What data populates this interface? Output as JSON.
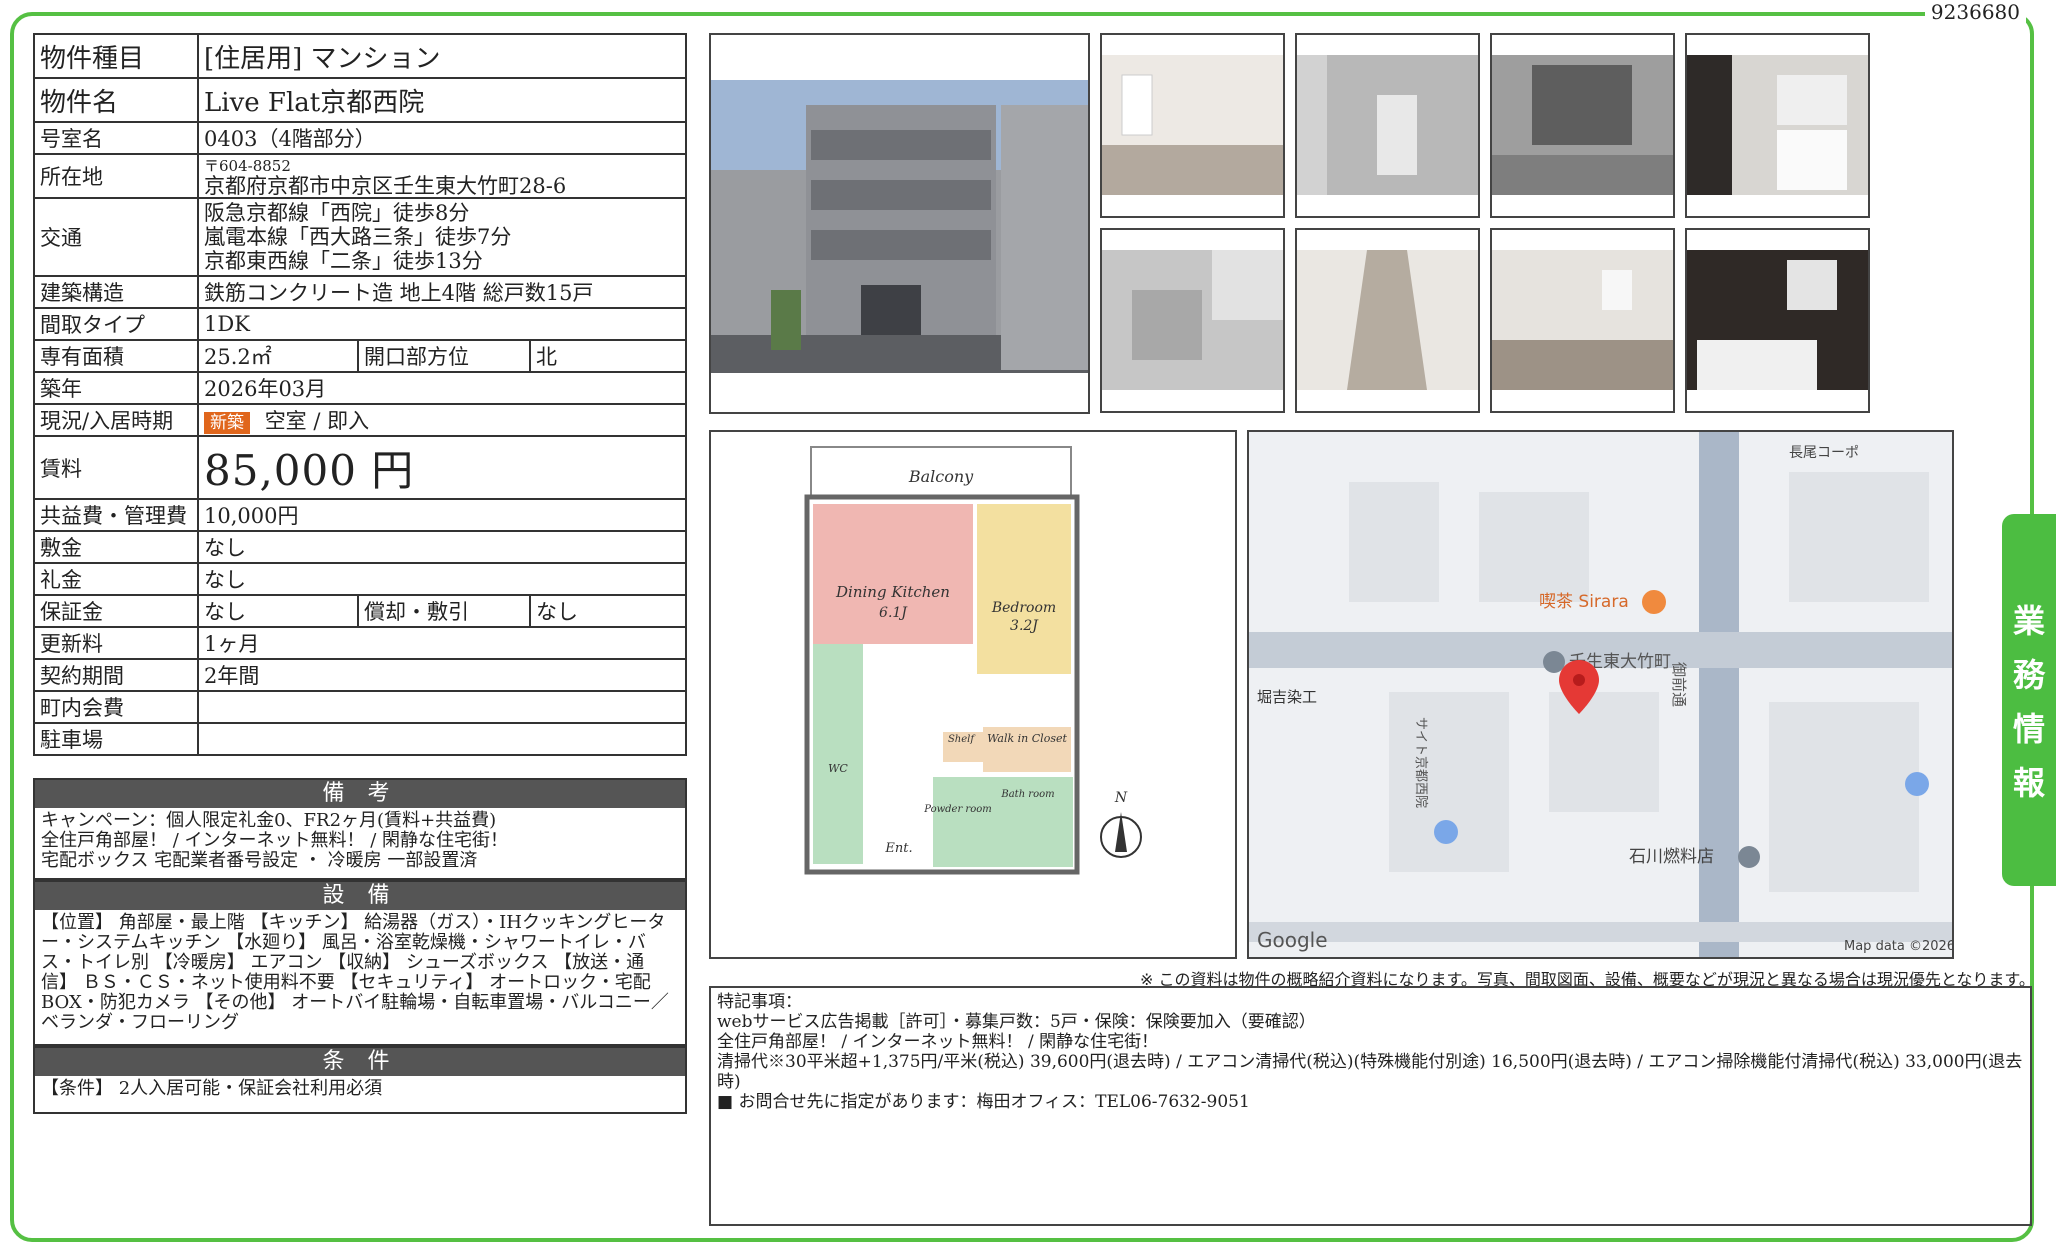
{
  "doc_id": "9236680",
  "side_tab": [
    "業",
    "務",
    "情",
    "報"
  ],
  "property": {
    "type_label": "物件種目",
    "type_value": "[住居用] マンション",
    "name_label": "物件名",
    "name_value": "Live Flat京都西院",
    "room_label": "号室名",
    "room_value": "0403（4階部分）",
    "address_label": "所在地",
    "zip": "〒604-8852",
    "address": "京都府京都市中京区壬生東大竹町28-6",
    "access_label": "交通",
    "access": [
      "阪急京都線「西院」徒歩8分",
      "嵐電本線「西大路三条」徒歩7分",
      "京都東西線「二条」徒歩13分"
    ],
    "structure_label": "建築構造",
    "structure_value": "鉄筋コンクリート造 地上4階 総戸数15戸",
    "layout_label": "間取タイプ",
    "layout_value": "1DK",
    "area_label": "専有面積",
    "area_value": "25.2㎡",
    "facing_label": "開口部方位",
    "facing_value": "北",
    "built_label": "築年",
    "built_value": "2026年03月",
    "status_label": "現況/入居時期",
    "status_badge": "新築",
    "status_value": "空室 / 即入",
    "rent_label": "賃料",
    "rent_value": "85,000 円",
    "fee_label": "共益費・管理費",
    "fee_value": "10,000円",
    "deposit_label": "敷金",
    "deposit_value": "なし",
    "key_money_label": "礼金",
    "key_money_value": "なし",
    "guarantee_label": "保証金",
    "guarantee_value": "なし",
    "amort_label": "償却・敷引",
    "amort_value": "なし",
    "renewal_label": "更新料",
    "renewal_value": "1ヶ月",
    "contract_label": "契約期間",
    "contract_value": "2年間",
    "assoc_label": "町内会費",
    "assoc_value": "",
    "parking_label": "駐車場",
    "parking_value": ""
  },
  "remarks": {
    "title": "備 考",
    "lines": [
      "キャンペーン：個人限定礼金0、FR2ヶ月(賃料+共益費)",
      "全住戸角部屋！ / インターネット無料！ / 閑静な住宅街！",
      "宅配ボックス 宅配業者番号設定 ・ 冷暖房 一部設置済"
    ]
  },
  "equipment": {
    "title": "設 備",
    "text": "【位置】 角部屋・最上階 【キッチン】 給湯器（ガス）・IHクッキングヒーター・システムキッチン 【水廻り】 風呂・浴室乾燥機・シャワートイレ・バス・トイレ別 【冷暖房】 エアコン 【収納】 シューズボックス 【放送・通信】 ＢＳ・ＣＳ・ネット使用料不要 【セキュリティ】 オートロック・宅配BOX・防犯カメラ 【その他】 オートバイ駐輪場・自転車置場・バルコニー／ベランダ・フローリング"
  },
  "conditions": {
    "title": "条 件",
    "text": "【条件】 2人入居可能・保証会社利用必須"
  },
  "floorplan": {
    "balcony": "Balcony",
    "dining": "Dining Kitchen",
    "dining_size": "6.1J",
    "bedroom": "Bedroom",
    "bedroom_size": "3.2J",
    "closet": "Walk in Closet",
    "shelf": "Shelf",
    "powder": "Powder room",
    "bath": "Bath room",
    "wc": "WC",
    "ent": "Ent.",
    "north": "N"
  },
  "map": {
    "labels": [
      "長尾コーポ",
      "喫茶 Sirara",
      "壬生東大竹町",
      "堀吉染工",
      "御前通",
      "サイト京都西院",
      "石川燃料店"
    ],
    "logo": "Google",
    "credit": "Map data ©2026"
  },
  "notice": "※ この資料は物件の概略紹介資料になります。写真、間取図面、設備、概要などが現況と異なる場合は現況優先となります。",
  "notes": {
    "heading": "特記事項：",
    "lines": [
      "webサービス広告掲載［許可］・募集戸数：5戸・保険：保険要加入（要確認）",
      "全住戸角部屋！ / インターネット無料！ / 閑静な住宅街！",
      "清掃代※30平米超+1,375円/平米(税込) 39,600円(退去時) / エアコン清掃代(税込)(特殊機能付別途) 16,500円(退去時) / エアコン掃除機能付清掃代(税込) 33,000円(退去時)",
      "■ お問合せ先に指定があります：梅田オフィス：TEL06-7632-9051"
    ]
  },
  "colors": {
    "frame": "#55c043",
    "side_tab": "#4cbd41",
    "section_header": "#555555",
    "new_badge": "#e0661c",
    "map_pin": "#e53935"
  }
}
